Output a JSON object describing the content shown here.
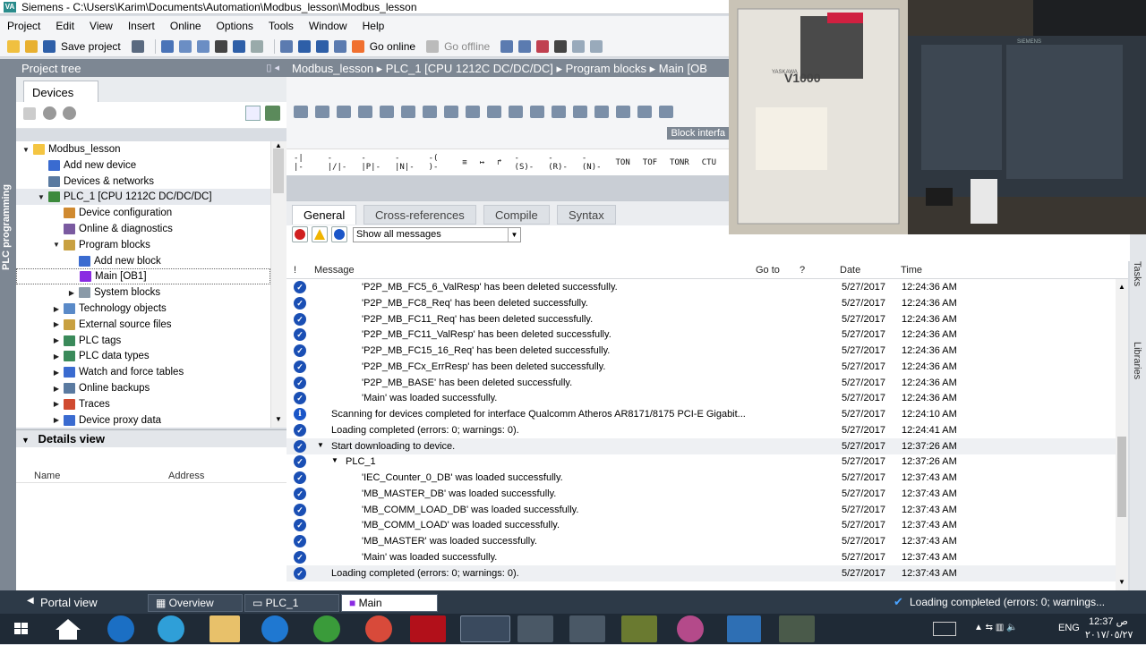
{
  "window": {
    "app": "Siemens",
    "title": "Siemens - C:\\Users\\Karim\\Documents\\Automation\\Modbus_lesson\\Modbus_lesson"
  },
  "menu": [
    "Project",
    "Edit",
    "View",
    "Insert",
    "Online",
    "Options",
    "Tools",
    "Window",
    "Help"
  ],
  "toolbar": {
    "save_project": "Save project",
    "go_online": "Go online",
    "go_offline": "Go offline"
  },
  "project_tree": {
    "title": "Project tree",
    "tab": "Devices",
    "items": [
      {
        "label": "Modbus_lesson",
        "indent": 0,
        "caret": "▼"
      },
      {
        "label": "Add new device",
        "indent": 1,
        "caret": ""
      },
      {
        "label": "Devices & networks",
        "indent": 1,
        "caret": ""
      },
      {
        "label": "PLC_1 [CPU 1212C DC/DC/DC]",
        "indent": 1,
        "caret": "▼"
      },
      {
        "label": "Device configuration",
        "indent": 2,
        "caret": ""
      },
      {
        "label": "Online & diagnostics",
        "indent": 2,
        "caret": ""
      },
      {
        "label": "Program blocks",
        "indent": 2,
        "caret": "▼"
      },
      {
        "label": "Add new block",
        "indent": 3,
        "caret": ""
      },
      {
        "label": "Main [OB1]",
        "indent": 3,
        "caret": ""
      },
      {
        "label": "System blocks",
        "indent": 3,
        "caret": "▶"
      },
      {
        "label": "Technology objects",
        "indent": 2,
        "caret": "▶"
      },
      {
        "label": "External source files",
        "indent": 2,
        "caret": "▶"
      },
      {
        "label": "PLC tags",
        "indent": 2,
        "caret": "▶"
      },
      {
        "label": "PLC data types",
        "indent": 2,
        "caret": "▶"
      },
      {
        "label": "Watch and force tables",
        "indent": 2,
        "caret": "▶"
      },
      {
        "label": "Online backups",
        "indent": 2,
        "caret": "▶"
      },
      {
        "label": "Traces",
        "indent": 2,
        "caret": "▶"
      },
      {
        "label": "Device proxy data",
        "indent": 2,
        "caret": "▶"
      }
    ]
  },
  "details_view": {
    "title": "Details view",
    "col_name": "Name",
    "col_address": "Address"
  },
  "side_strip": "PLC programming",
  "editor": {
    "breadcrumb": "Modbus_lesson  ▸  PLC_1 [CPU 1212C DC/DC/DC]  ▸  Program blocks  ▸  Main [OB",
    "block_interface": "Block interfa",
    "ladder_items": [
      "-| |-",
      "-|/|-",
      "-|P|-",
      "-|N|-",
      "-( )-",
      "≡",
      "↦",
      "↱",
      "-(S)-",
      "-(R)-",
      "-(N)-",
      "TON",
      "TOF",
      "TONR",
      "CTU"
    ]
  },
  "inspector": {
    "tabs": [
      "General",
      "Cross-references",
      "Compile",
      "Syntax"
    ],
    "filter": "Show all messages",
    "columns": {
      "i": "!",
      "message": "Message",
      "goto": "Go to",
      "q": "?",
      "date": "Date",
      "time": "Time"
    }
  },
  "messages": [
    {
      "text": "'P2P_MB_FC5_6_ValResp' has been deleted successfully.",
      "date": "5/27/2017",
      "time": "12:24:36 AM",
      "indent": 3,
      "icon": "check",
      "tri": ""
    },
    {
      "text": "'P2P_MB_FC8_Req' has been deleted successfully.",
      "date": "5/27/2017",
      "time": "12:24:36 AM",
      "indent": 3,
      "icon": "check",
      "tri": ""
    },
    {
      "text": "'P2P_MB_FC11_Req' has been deleted successfully.",
      "date": "5/27/2017",
      "time": "12:24:36 AM",
      "indent": 3,
      "icon": "check",
      "tri": ""
    },
    {
      "text": "'P2P_MB_FC11_ValResp' has been deleted successfully.",
      "date": "5/27/2017",
      "time": "12:24:36 AM",
      "indent": 3,
      "icon": "check",
      "tri": ""
    },
    {
      "text": "'P2P_MB_FC15_16_Req' has been deleted successfully.",
      "date": "5/27/2017",
      "time": "12:24:36 AM",
      "indent": 3,
      "icon": "check",
      "tri": ""
    },
    {
      "text": "'P2P_MB_FCx_ErrResp' has been deleted successfully.",
      "date": "5/27/2017",
      "time": "12:24:36 AM",
      "indent": 3,
      "icon": "check",
      "tri": ""
    },
    {
      "text": "'P2P_MB_BASE' has been deleted successfully.",
      "date": "5/27/2017",
      "time": "12:24:36 AM",
      "indent": 3,
      "icon": "check",
      "tri": ""
    },
    {
      "text": "'Main' was loaded successfully.",
      "date": "5/27/2017",
      "time": "12:24:36 AM",
      "indent": 3,
      "icon": "check",
      "tri": ""
    },
    {
      "text": "Scanning for devices completed for interface Qualcomm Atheros AR8171/8175 PCI-E Gigabit...",
      "date": "5/27/2017",
      "time": "12:24:10 AM",
      "indent": 1,
      "icon": "info",
      "tri": ""
    },
    {
      "text": "Loading completed (errors: 0; warnings: 0).",
      "date": "5/27/2017",
      "time": "12:24:41 AM",
      "indent": 1,
      "icon": "check",
      "tri": ""
    },
    {
      "text": "Start downloading to device.",
      "date": "5/27/2017",
      "time": "12:37:26 AM",
      "indent": 1,
      "icon": "check",
      "tri": "▼"
    },
    {
      "text": "PLC_1",
      "date": "5/27/2017",
      "time": "12:37:26 AM",
      "indent": 2,
      "icon": "check",
      "tri": "▼"
    },
    {
      "text": "'IEC_Counter_0_DB' was loaded successfully.",
      "date": "5/27/2017",
      "time": "12:37:43 AM",
      "indent": 3,
      "icon": "check",
      "tri": ""
    },
    {
      "text": "'MB_MASTER_DB' was loaded successfully.",
      "date": "5/27/2017",
      "time": "12:37:43 AM",
      "indent": 3,
      "icon": "check",
      "tri": ""
    },
    {
      "text": "'MB_COMM_LOAD_DB' was loaded successfully.",
      "date": "5/27/2017",
      "time": "12:37:43 AM",
      "indent": 3,
      "icon": "check",
      "tri": ""
    },
    {
      "text": "'MB_COMM_LOAD' was loaded successfully.",
      "date": "5/27/2017",
      "time": "12:37:43 AM",
      "indent": 3,
      "icon": "check",
      "tri": ""
    },
    {
      "text": "'MB_MASTER' was loaded successfully.",
      "date": "5/27/2017",
      "time": "12:37:43 AM",
      "indent": 3,
      "icon": "check",
      "tri": ""
    },
    {
      "text": "'Main' was loaded successfully.",
      "date": "5/27/2017",
      "time": "12:37:43 AM",
      "indent": 3,
      "icon": "check",
      "tri": ""
    },
    {
      "text": "Loading completed (errors: 0; warnings: 0).",
      "date": "5/27/2017",
      "time": "12:37:43 AM",
      "indent": 1,
      "icon": "check",
      "tri": ""
    }
  ],
  "right_strip": [
    "Tasks",
    "Libraries"
  ],
  "video": {
    "drive_label": "V1000",
    "brand": "YASKAWA",
    "plc_brand": "SIEMENS"
  },
  "statusbar": {
    "portal_view": "Portal view",
    "tabs": [
      "Overview",
      "PLC_1",
      "Main"
    ],
    "status_text": "Loading completed (errors: 0; warnings..."
  },
  "taskbar": {
    "lang": "ENG",
    "clock_time": "12:37 ص",
    "clock_date": "٢٠١٧/٠٥/٢٧"
  }
}
